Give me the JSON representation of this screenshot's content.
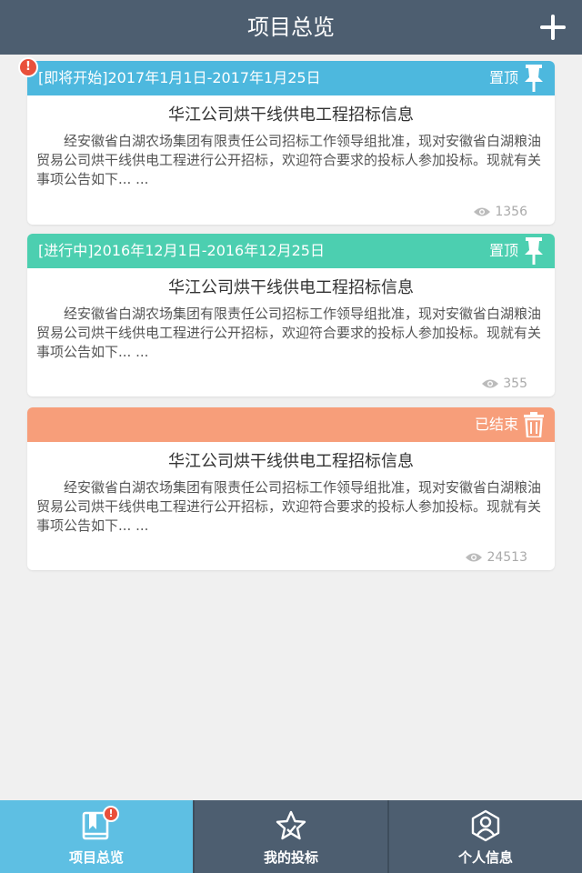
{
  "header": {
    "title": "项目总览",
    "add_icon": "plus-icon"
  },
  "colors": {
    "header": "#4d5e70",
    "upcoming": "#4db8de",
    "in_progress": "#4ccfb0",
    "ended": "#f79e7a",
    "active_tab": "#5ebfe3",
    "alert": "#e9503b"
  },
  "cards": [
    {
      "status": "[即将开始]2017年1月1日-2017年1月25日",
      "action_label": "置顶",
      "action_icon": "pin-icon",
      "title": "华江公司烘干线供电工程招标信息",
      "body": "经安徽省白湖农场集团有限责任公司招标工作领导组批准，现对安徽省白湖粮油贸易公司烘干线供电工程进行公开招标，欢迎符合要求的投标人参加投标。现就有关事项公告如下... ...",
      "views": "1356",
      "alert": "!"
    },
    {
      "status": "[进行中]2016年12月1日-2016年12月25日",
      "action_label": "置顶",
      "action_icon": "pin-icon",
      "title": "华江公司烘干线供电工程招标信息",
      "body": "经安徽省白湖农场集团有限责任公司招标工作领导组批准，现对安徽省白湖粮油贸易公司烘干线供电工程进行公开招标，欢迎符合要求的投标人参加投标。现就有关事项公告如下... ...",
      "views": "355"
    },
    {
      "status": "",
      "action_label": "已结束",
      "action_icon": "trash-icon",
      "title": "华江公司烘干线供电工程招标信息",
      "body": "经安徽省白湖农场集团有限责任公司招标工作领导组批准，现对安徽省白湖粮油贸易公司烘干线供电工程进行公开招标，欢迎符合要求的投标人参加投标。现就有关事项公告如下... ...",
      "views": "24513"
    }
  ],
  "tabs": [
    {
      "label": "项目总览",
      "icon": "book-icon",
      "active": true,
      "badge": "!"
    },
    {
      "label": "我的投标",
      "icon": "star-icon",
      "active": false
    },
    {
      "label": "个人信息",
      "icon": "user-icon",
      "active": false
    }
  ]
}
